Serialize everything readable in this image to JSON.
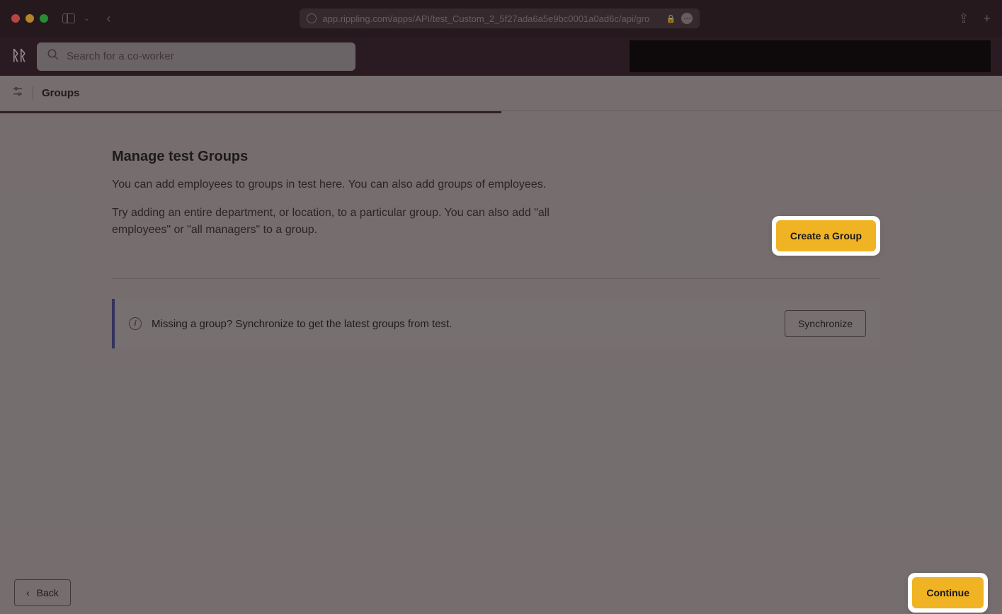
{
  "browser": {
    "url": "app.rippling.com/apps/API/test_Custom_2_5f27ada6a5e9bc0001a0ad6c/api/gro"
  },
  "header": {
    "logo": "ᚱᚱ",
    "search_placeholder": "Search for a co-worker"
  },
  "breadcrumb": {
    "title": "Groups"
  },
  "main": {
    "title": "Manage test Groups",
    "description1": "You can add employees to groups in test here. You can also add groups of employees.",
    "description2": "Try adding an entire department, or location, to a particular group. You can also add \"all employees\" or \"all managers\" to a group.",
    "create_button": "Create a Group"
  },
  "info_banner": {
    "text": "Missing a group? Synchronize to get the latest groups from test.",
    "sync_button": "Synchronize"
  },
  "footer": {
    "back_label": "Back",
    "continue_label": "Continue"
  }
}
